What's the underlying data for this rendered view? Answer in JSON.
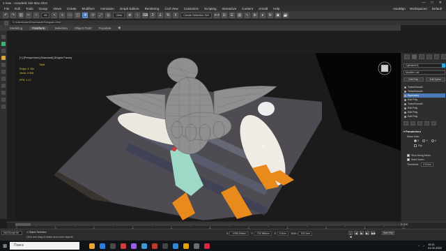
{
  "app": {
    "window_title": "2.max - Autodesk 3ds Max 2021",
    "window_controls": [
      "—",
      "□",
      "✕"
    ]
  },
  "menu": {
    "items": [
      "File",
      "Edit",
      "Tools",
      "Group",
      "Views",
      "Create",
      "Modifiers",
      "Animation",
      "Graph Editors",
      "Rendering",
      "Civil View",
      "Customize",
      "Scripting",
      "Interactive",
      "Content",
      "Arnold",
      "Help"
    ],
    "user": "maxBlgo",
    "workspaces_label": "Workspaces:",
    "workspace_value": "Default"
  },
  "toolbar": {
    "filter_value": "All",
    "view_value": "View",
    "selection_set": "Create Selection Set"
  },
  "pathbar": {
    "path": "C:\\Users\\User\\Downloads\\Telegram Desktop"
  },
  "ribbon": {
    "tabs": [
      "Modeling",
      "Freeform",
      "Selection",
      "Object Paint",
      "Populate"
    ],
    "selected": "Freeform"
  },
  "viewport": {
    "label": "[+] [Perspective] [Standard] [Edged Faces]",
    "stats_title": "Total",
    "stats": [
      {
        "label": "Polys:",
        "value": "4 784"
      },
      {
        "label": "Verts:",
        "value": "4 906"
      }
    ],
    "fps_label": "FPS:",
    "fps_value": "1.17"
  },
  "command_panel": {
    "object_name": "Cylinder011",
    "modifier_list": "Modifier List",
    "set_buttons": [
      "Edit Poly",
      "Edit Spline"
    ],
    "stack": [
      {
        "label": "TurboSmooth",
        "selected": false
      },
      {
        "label": "TurboSmooth",
        "selected": false
      },
      {
        "label": "Symmetry",
        "selected": true
      },
      {
        "label": "Edit Poly",
        "selected": false
      },
      {
        "label": "TurboSmooth",
        "selected": false
      },
      {
        "label": "Edit Poly",
        "selected": false
      },
      {
        "label": "Edit Poly",
        "selected": false
      },
      {
        "label": "Edit Poly",
        "selected": false
      },
      {
        "label": "Cylinder",
        "selected": false
      }
    ],
    "params_title": "Parameters",
    "mirror_axis_label": "Mirror Axis:",
    "axes": [
      {
        "label": "X",
        "on": true
      },
      {
        "label": "Y",
        "on": false
      },
      {
        "label": "Z",
        "on": false
      }
    ],
    "flip_label": "Flip",
    "options": [
      {
        "label": "Slice Along Mirror",
        "on": true
      },
      {
        "label": "Weld Seam",
        "on": true
      }
    ],
    "threshold_label": "Threshold:",
    "threshold_value": "0.01cm"
  },
  "timeline": {
    "frame_display": "0 / 100",
    "tick_labels": [
      "0",
      "10",
      "20",
      "30",
      "40",
      "50",
      "60",
      "70",
      "80",
      "90",
      "100"
    ]
  },
  "status": {
    "maxscript": "MAXScript Mi",
    "line1": "1 Object Selected",
    "line2": "Click and drag to select and move objects",
    "coords": [
      {
        "axis": "X:",
        "value": "-1096.206cm"
      },
      {
        "axis": "Y:",
        "value": "-702.866cm"
      },
      {
        "axis": "Z:",
        "value": "0.0cm"
      },
      {
        "axis": "Grid =",
        "value": "100.0cm"
      }
    ],
    "autokey": "Auto Key",
    "play_controls": [
      "|◀",
      "◀",
      "▶",
      "▶|",
      "▶▶"
    ]
  },
  "taskbar": {
    "search_placeholder": "Поиск",
    "clock": "15:11",
    "date": "01.02.2022",
    "icon_colors": [
      "#e8a735",
      "#2d7de0",
      "#4a4a4a",
      "#d23c3c",
      "#9b5de5",
      "#3c9dd6",
      "#c0392b",
      "#444444",
      "#2f86d6",
      "#e5a100",
      "#6c6c6c",
      "#d7263d"
    ]
  }
}
